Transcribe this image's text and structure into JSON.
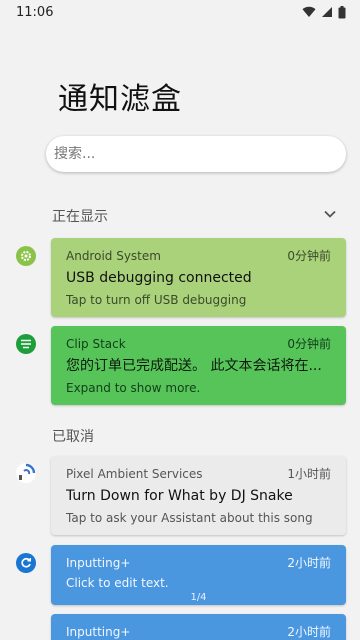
{
  "status_bar": {
    "time": "11:06"
  },
  "app": {
    "title": "通知滤盒"
  },
  "search": {
    "placeholder": "搜索..."
  },
  "sections": {
    "showing": "正在显示",
    "cancelled": "已取消"
  },
  "notifications": [
    {
      "app": "Android System",
      "time": "0分钟前",
      "title": "USB debugging connected",
      "text": "Tap to turn off USB debugging",
      "color": "#aad27b",
      "icon": "gear-icon"
    },
    {
      "app": "Clip Stack",
      "time": "0分钟前",
      "title": "您的订单已完成配送。 此文本会话将在...",
      "text": "Expand to show more.",
      "color": "#57c45a",
      "icon": "clipboard-list-icon"
    },
    {
      "app": "Pixel Ambient Services",
      "time": "1小时前",
      "title": "Turn Down for What by DJ Snake",
      "text": "Tap to ask your Assistant about this song",
      "color": "#ebebeb",
      "icon": "ambient-music-icon"
    },
    {
      "app": "Inputting+",
      "time": "2小时前",
      "title": "",
      "text": "Click to edit text.",
      "pager": "1/4",
      "color": "#4a97e0",
      "icon": "refresh-icon"
    },
    {
      "app": "Inputting+",
      "time": "2小时前",
      "title": "",
      "text": "",
      "color": "#4a97e0",
      "icon": "refresh-icon"
    }
  ]
}
